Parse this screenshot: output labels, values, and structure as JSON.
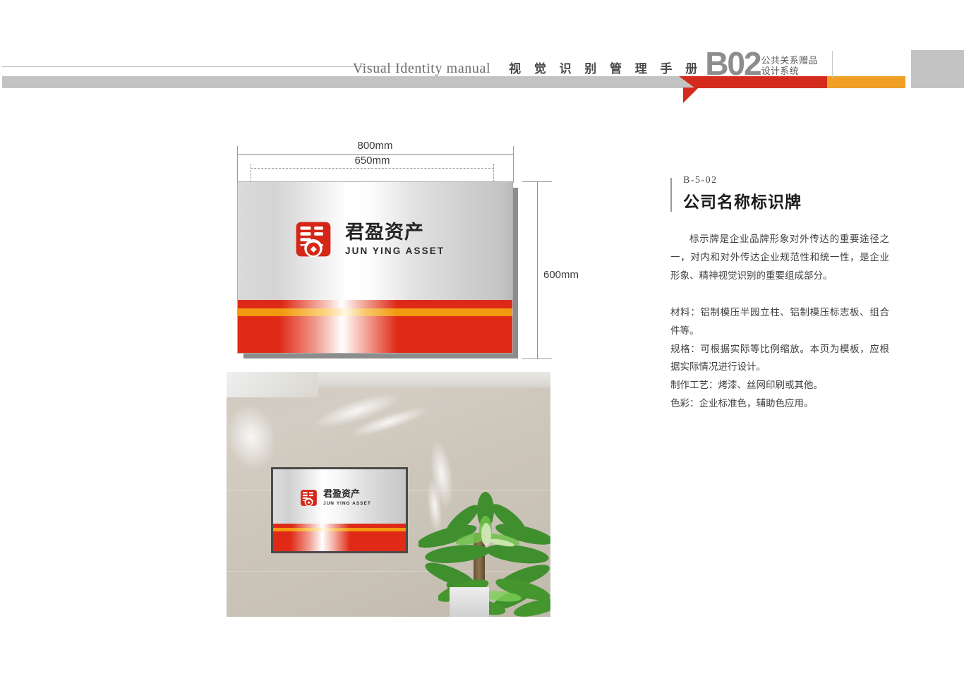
{
  "header": {
    "english_title": "Visual Identity  manual",
    "chinese_title": "视 觉 识 别 管 理 手 册",
    "section_code": "B02",
    "section_name_line1": "公共关系赠品",
    "section_name_line2": "设计系统",
    "colors": {
      "gray": "#c3c3c3",
      "red": "#d32b1e",
      "orange": "#f0a024"
    }
  },
  "drawing": {
    "dim_width_outer": "800mm",
    "dim_width_inner": "650mm",
    "dim_height": "600mm",
    "sign": {
      "logo_cn": "君盈资产",
      "logo_en": "JUN YING ASSET",
      "brand_red": "#e02a17",
      "brand_orange": "#f2990f"
    }
  },
  "photo": {
    "sign": {
      "logo_cn": "君盈资产",
      "logo_en": "JUN YING ASSET"
    }
  },
  "panel": {
    "code": "B-5-02",
    "title": "公司名称标识牌",
    "intro": "标示牌是企业品牌形象对外传达的重要途径之一，对内和对外传达企业规范性和统一性，是企业形象、精神视觉识别的重要组成部分。",
    "specs": [
      "材料：铝制模压半园立柱、铝制模压标志板、组合件等。",
      " 规格：可根据实际等比例缩放。本页为模板，应根据实际情况进行设计。",
      "制作工艺：烤漆、丝网印刷或其他。",
      " 色彩：企业标准色，辅助色应用。"
    ]
  }
}
